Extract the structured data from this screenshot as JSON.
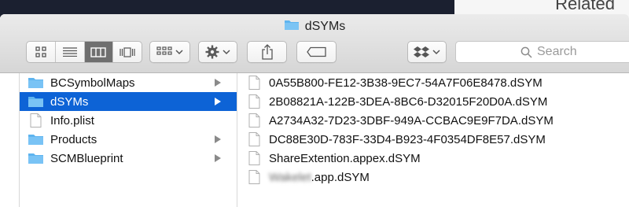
{
  "window": {
    "title": "dSYMs"
  },
  "background": {
    "partial_text": "Related"
  },
  "toolbar": {
    "view_modes": [
      "icon-view",
      "list-view",
      "column-view",
      "cover-flow-view"
    ],
    "active_view": 2,
    "search": {
      "placeholder": "Search"
    }
  },
  "sidebar_column": {
    "items": [
      {
        "label": "BCSymbolMaps",
        "type": "folder",
        "has_children": true,
        "selected": false
      },
      {
        "label": "dSYMs",
        "type": "folder",
        "has_children": true,
        "selected": true
      },
      {
        "label": "Info.plist",
        "type": "file",
        "has_children": false,
        "selected": false
      },
      {
        "label": "Products",
        "type": "folder",
        "has_children": true,
        "selected": false
      },
      {
        "label": "SCMBlueprint",
        "type": "folder",
        "has_children": true,
        "selected": false
      }
    ]
  },
  "files_column": {
    "items": [
      {
        "label": "0A55B800-FE12-3B38-9EC7-54A7F06E8478.dSYM"
      },
      {
        "label": "2B08821A-122B-3DEA-8BC6-D32015F20D0A.dSYM"
      },
      {
        "label": "A2734A32-7D23-3DBF-949A-CCBAC9E9F7DA.dSYM"
      },
      {
        "label": "DC88E30D-783F-33D4-B923-4F0354DF8E57.dSYM"
      },
      {
        "label": "ShareExtention.appex.dSYM"
      },
      {
        "label_redacted": "Wakelet",
        "label_suffix": ".app.dSYM"
      }
    ]
  },
  "colors": {
    "selection": "#0d63d6",
    "folder": "#5eb4ef",
    "titlebar": "#dcdcdc"
  }
}
